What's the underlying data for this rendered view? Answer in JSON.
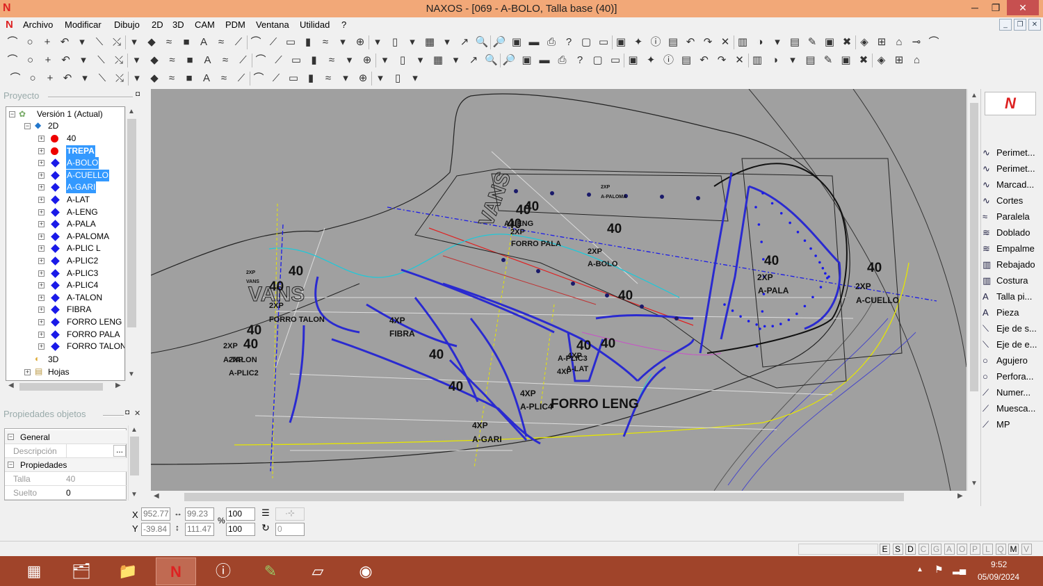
{
  "window": {
    "title": "NAXOS - [069 - A-BOLO, Talla base (40)]",
    "logo_letter": "N",
    "controls": {
      "minimize": "─",
      "restore": "❐",
      "close": "✕"
    }
  },
  "menu": {
    "items": [
      "Archivo",
      "Modificar",
      "Dibujo",
      "2D",
      "3D",
      "CAM",
      "PDM",
      "Ventana",
      "Utilidad",
      "?"
    ],
    "mdi_controls": [
      "_",
      "❐",
      "✕"
    ]
  },
  "project_panel": {
    "title": "Proyecto",
    "tree": {
      "root": "Versión 1 (Actual)",
      "group_2d": "2D",
      "items": [
        {
          "label": "40",
          "marker": "red-dot"
        },
        {
          "label": "TREPA",
          "marker": "red-dot",
          "selected": true
        },
        {
          "label": "A-BOLO",
          "marker": "blue-diamond",
          "selected": true
        },
        {
          "label": "A-CUELLO",
          "marker": "blue-diamond",
          "selected": true
        },
        {
          "label": "A-GARI",
          "marker": "blue-diamond",
          "selected": true
        },
        {
          "label": "A-LAT",
          "marker": "blue-diamond"
        },
        {
          "label": "A-LENG",
          "marker": "blue-diamond"
        },
        {
          "label": "A-PALA",
          "marker": "blue-diamond"
        },
        {
          "label": "A-PALOMA",
          "marker": "blue-diamond"
        },
        {
          "label": "A-PLIC L",
          "marker": "blue-diamond"
        },
        {
          "label": "A-PLIC2",
          "marker": "blue-diamond"
        },
        {
          "label": "A-PLIC3",
          "marker": "blue-diamond"
        },
        {
          "label": "A-PLIC4",
          "marker": "blue-diamond"
        },
        {
          "label": "A-TALON",
          "marker": "blue-diamond"
        },
        {
          "label": "FIBRA",
          "marker": "blue-diamond"
        },
        {
          "label": "FORRO LENG",
          "marker": "blue-diamond"
        },
        {
          "label": "FORRO PALA",
          "marker": "blue-diamond"
        },
        {
          "label": "FORRO TALON",
          "marker": "blue-diamond"
        }
      ],
      "group_3d": "3D",
      "group_hojas": "Hojas"
    }
  },
  "properties_panel": {
    "title": "Propiedades objetos",
    "sections": [
      {
        "name": "General",
        "rows": [
          {
            "key": "Descripción",
            "value": ""
          }
        ]
      },
      {
        "name": "Propiedades",
        "rows": [
          {
            "key": "Talla",
            "value": "40"
          },
          {
            "key": "Suelto",
            "value": "0"
          }
        ]
      }
    ],
    "ellipsis": "..."
  },
  "coords": {
    "x_label": "X",
    "y_label": "Y",
    "x_value": "952.77",
    "y_value": "-39.84",
    "dx_value": "99.23",
    "dy_value": "111.47",
    "scale_x": "100",
    "scale_y": "100",
    "percent": "%",
    "rotation": "0"
  },
  "right_tools": [
    {
      "label": "Perimet...",
      "icon": "curve-icon"
    },
    {
      "label": "Perimet...",
      "icon": "curve-icon"
    },
    {
      "label": "Marcad...",
      "icon": "curve-icon"
    },
    {
      "label": "Cortes",
      "icon": "curve-icon"
    },
    {
      "label": "Paralela",
      "icon": "parallel-icon"
    },
    {
      "label": "Doblado",
      "icon": "fold-icon"
    },
    {
      "label": "Empalme",
      "icon": "join-icon"
    },
    {
      "label": "Rebajado",
      "icon": "skive-icon"
    },
    {
      "label": "Costura",
      "icon": "seam-icon"
    },
    {
      "label": "Talla pi...",
      "icon": "text-icon"
    },
    {
      "label": "Pieza",
      "icon": "text-icon"
    },
    {
      "label": "Eje de s...",
      "icon": "axis-icon"
    },
    {
      "label": "Eje de e...",
      "icon": "axis-icon"
    },
    {
      "label": "Agujero",
      "icon": "circle-icon"
    },
    {
      "label": "Perfora...",
      "icon": "circle-icon"
    },
    {
      "label": "Numer...",
      "icon": "number-icon"
    },
    {
      "label": "Muesca...",
      "icon": "notch-icon"
    },
    {
      "label": "MP",
      "icon": "mp-icon"
    }
  ],
  "canvas_labels": [
    {
      "text": "40"
    },
    {
      "text": "40"
    },
    {
      "text": "40"
    },
    {
      "text": "40"
    },
    {
      "text": "40"
    },
    {
      "text": "40"
    },
    {
      "text": "40"
    },
    {
      "text": "40"
    },
    {
      "text": "40"
    },
    {
      "text": "40"
    },
    {
      "text": "40"
    },
    {
      "text": "40"
    },
    {
      "text": "40"
    },
    {
      "text": "40"
    },
    {
      "text": "40"
    },
    {
      "text": "FORRO LENG"
    },
    {
      "text": "A-LENG"
    },
    {
      "text": "2XP"
    },
    {
      "text": "FORRO PALA"
    },
    {
      "text": "2XP"
    },
    {
      "text": "A-BOLO"
    },
    {
      "text": "2XP"
    },
    {
      "text": "A-PALA"
    },
    {
      "text": "2XP"
    },
    {
      "text": "A-CUELLO"
    },
    {
      "text": "4XP"
    },
    {
      "text": "FIBRA"
    },
    {
      "text": "2XP"
    },
    {
      "text": "FORRO TALON"
    },
    {
      "text": "2XP"
    },
    {
      "text": "A-TALON"
    },
    {
      "text": "2XP"
    },
    {
      "text": "A-PLIC2"
    },
    {
      "text": "A-PLIC3"
    },
    {
      "text": "4XP"
    },
    {
      "text": "4XP"
    },
    {
      "text": "A-LAT"
    },
    {
      "text": "4XP"
    },
    {
      "text": "A-PLIC4"
    },
    {
      "text": "4XP"
    },
    {
      "text": "A-GARI"
    },
    {
      "text": "2XP"
    },
    {
      "text": "A-PALOMA"
    },
    {
      "text": "2XP"
    },
    {
      "text": "VANS"
    },
    {
      "text": "VANS"
    }
  ],
  "status_keys": [
    "E",
    "S",
    "D",
    "C",
    "G",
    "A",
    "O",
    "P",
    "L",
    "Q",
    "M",
    "V"
  ],
  "taskbar": {
    "time": "9:52",
    "date": "05/09/2024"
  }
}
